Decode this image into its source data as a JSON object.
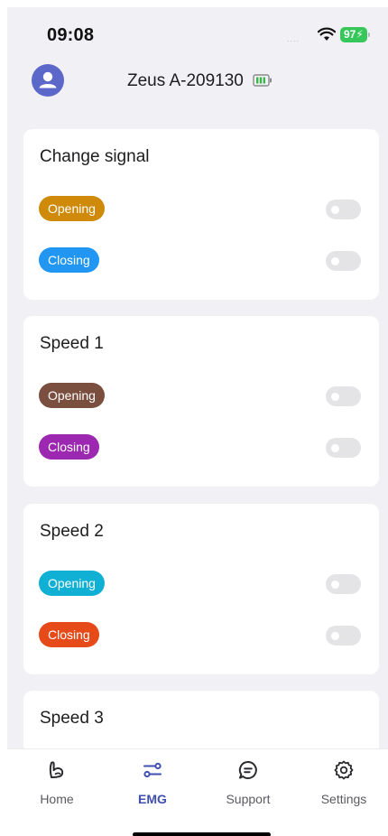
{
  "status_bar": {
    "time": "09:08",
    "signal_dots": "....",
    "battery_level": "97",
    "wifi_icon": "wifi-icon"
  },
  "header": {
    "avatar_icon": "user-avatar-icon",
    "device_name": "Zeus A-209130",
    "device_battery_icon": "battery-icon",
    "device_battery_color": "#3bb54a"
  },
  "cards": [
    {
      "title": "Change signal",
      "rows": [
        {
          "label": "Opening",
          "color": "#d08a0a",
          "enabled": false
        },
        {
          "label": "Closing",
          "color": "#2196f3",
          "enabled": false
        }
      ]
    },
    {
      "title": "Speed 1",
      "rows": [
        {
          "label": "Opening",
          "color": "#7b4f3f",
          "enabled": false
        },
        {
          "label": "Closing",
          "color": "#9c27b0",
          "enabled": false
        }
      ]
    },
    {
      "title": "Speed 2",
      "rows": [
        {
          "label": "Opening",
          "color": "#10b0d4",
          "enabled": false
        },
        {
          "label": "Closing",
          "color": "#e64a19",
          "enabled": false
        }
      ]
    },
    {
      "title": "Speed 3",
      "rows": []
    }
  ],
  "tabbar": {
    "active": "EMG",
    "tabs": [
      {
        "label": "Home",
        "icon": "arm-muscle-icon"
      },
      {
        "label": "EMG",
        "icon": "sliders-icon"
      },
      {
        "label": "Support",
        "icon": "chat-bubble-icon"
      },
      {
        "label": "Settings",
        "icon": "gear-icon"
      }
    ]
  },
  "colors": {
    "accent": "#3f4fb0",
    "background": "#f1f1f5",
    "avatar": "#5b67c9",
    "status_battery": "#35c759"
  }
}
